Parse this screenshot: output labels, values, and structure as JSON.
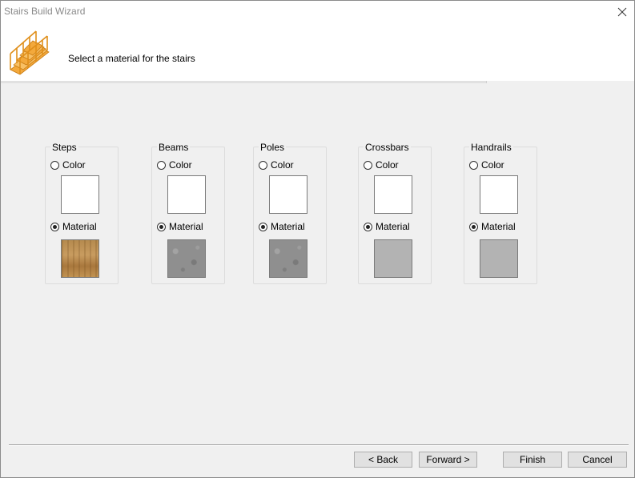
{
  "window": {
    "title": "Stairs Build Wizard"
  },
  "header": {
    "instruction": "Select a material for the stairs"
  },
  "groups": [
    {
      "label": "Steps",
      "color_label": "Color",
      "material_label": "Material",
      "selected": "material",
      "material": "wood"
    },
    {
      "label": "Beams",
      "color_label": "Color",
      "material_label": "Material",
      "selected": "material",
      "material": "concrete"
    },
    {
      "label": "Poles",
      "color_label": "Color",
      "material_label": "Material",
      "selected": "material",
      "material": "concrete"
    },
    {
      "label": "Crossbars",
      "color_label": "Color",
      "material_label": "Material",
      "selected": "material",
      "material": "gray"
    },
    {
      "label": "Handrails",
      "color_label": "Color",
      "material_label": "Material",
      "selected": "material",
      "material": "gray"
    }
  ],
  "buttons": {
    "back": "< Back",
    "forward": "Forward >",
    "finish": "Finish",
    "cancel": "Cancel"
  },
  "colors": {
    "color_swatch": "#ffffff",
    "gray_material": "#b3b3b3"
  }
}
